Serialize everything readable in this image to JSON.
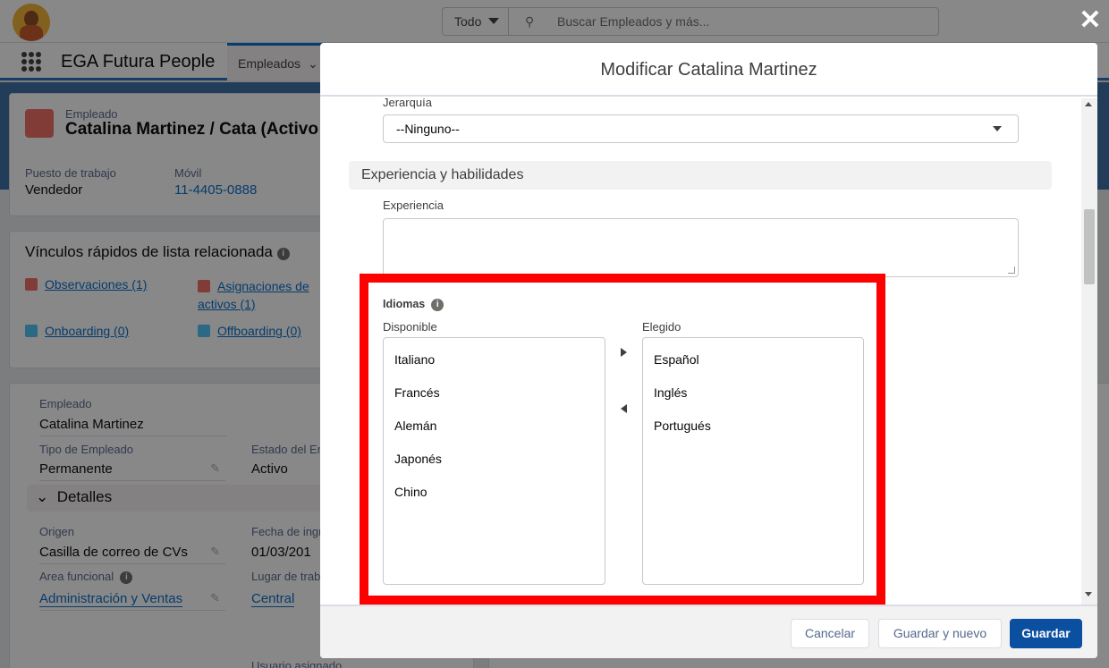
{
  "header": {
    "search_scope": "Todo",
    "search_placeholder": "Buscar Empleados y más...",
    "app_name": "EGA Futura People",
    "nav_tab": "Empleados"
  },
  "record": {
    "object_label": "Empleado",
    "title": "Catalina Martinez / Cata (Activo",
    "fields": [
      {
        "label": "Puesto de trabajo",
        "value": "Vendedor"
      },
      {
        "label": "Móvil",
        "value": "11-4405-0888"
      }
    ]
  },
  "related": {
    "title": "Vínculos rápidos de lista relacionada",
    "links": [
      "Observaciones (1)",
      "Asignaciones de activos (1)",
      "Onboarding (0)",
      "Offboarding (0)"
    ]
  },
  "details": {
    "empleado_label": "Empleado",
    "empleado_value": "Catalina Martinez",
    "tipo_label": "Tipo de Empleado",
    "tipo_value": "Permanente",
    "estado_label": "Estado del Em",
    "estado_value": "Activo",
    "section": "Detalles",
    "origen_label": "Origen",
    "origen_value": "Casilla de correo de CVs",
    "fecha_label": "Fecha de ingr",
    "fecha_value": "01/03/201",
    "area_label": "Area funcional",
    "area_value": "Administración y Ventas",
    "lugar_label": "Lugar de trab",
    "lugar_value": "Central",
    "usuario_label": "Usuario asignado"
  },
  "modal": {
    "title": "Modificar Catalina Martinez",
    "jerarquia_label": "Jerarquía",
    "jerarquia_value": "--Ninguno--",
    "section_title": "Experiencia y habilidades",
    "experiencia_label": "Experiencia",
    "idiomas_label": "Idiomas",
    "available_label": "Disponible",
    "chosen_label": "Elegido",
    "available": [
      "Italiano",
      "Francés",
      "Alemán",
      "Japonés",
      "Chino"
    ],
    "chosen": [
      "Español",
      "Inglés",
      "Portugués"
    ],
    "buttons": {
      "cancel": "Cancelar",
      "save_new": "Guardar y nuevo",
      "save": "Guardar"
    }
  },
  "colors": {
    "highlight": "#ff0000",
    "primary": "#0b4fa0",
    "link": "#006dcc"
  }
}
